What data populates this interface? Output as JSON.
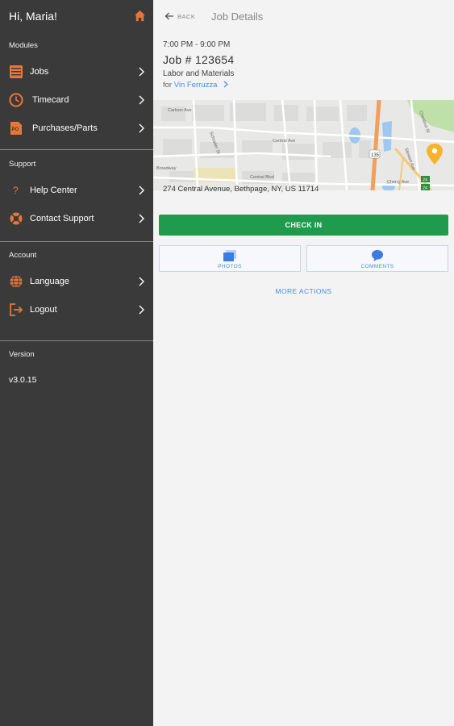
{
  "sidebar": {
    "greeting": "Hi, Maria!",
    "sections": {
      "modules": "Modules",
      "support": "Support",
      "account": "Account",
      "version": "Version"
    },
    "items": [
      {
        "label": "Jobs",
        "icon": "jobs-icon"
      },
      {
        "label": "Timecard",
        "icon": "clock-icon"
      },
      {
        "label": "Purchases/Parts",
        "icon": "po-icon"
      },
      {
        "label": "Help Center",
        "icon": "question-icon"
      },
      {
        "label": "Contact Support",
        "icon": "lifebuoy-icon"
      },
      {
        "label": "Language",
        "icon": "globe-icon"
      },
      {
        "label": "Logout",
        "icon": "logout-icon"
      }
    ],
    "version_value": "v3.0.15",
    "accent_color": "#e8763a"
  },
  "header": {
    "back_label": "BACK",
    "title": "Job Details"
  },
  "job": {
    "time_range": "7:00 PM - 9:00 PM",
    "number": "Job # 123654",
    "type": "Labor and Materials",
    "for_label": "for",
    "customer": "Vin Ferruzza",
    "address": "274 Central Avenue, Bethpage, NY, US 11714"
  },
  "map": {
    "streets": [
      "Carlson Ave",
      "Central Ave",
      "Central Blvd",
      "Stewart Ave",
      "Schrader St",
      "Chestnut St",
      "Cherry Ave",
      "Broadway"
    ],
    "routes": [
      "135",
      "24"
    ]
  },
  "actions": {
    "check_in": "CHECK IN",
    "photos": "PHOTOS",
    "comments": "COMMENTS",
    "more_actions": "MORE ACTIONS"
  },
  "colors": {
    "sidebar_bg": "#3a3a3a",
    "checkin_green": "#1f9b4d",
    "link_blue": "#4a8be0"
  }
}
